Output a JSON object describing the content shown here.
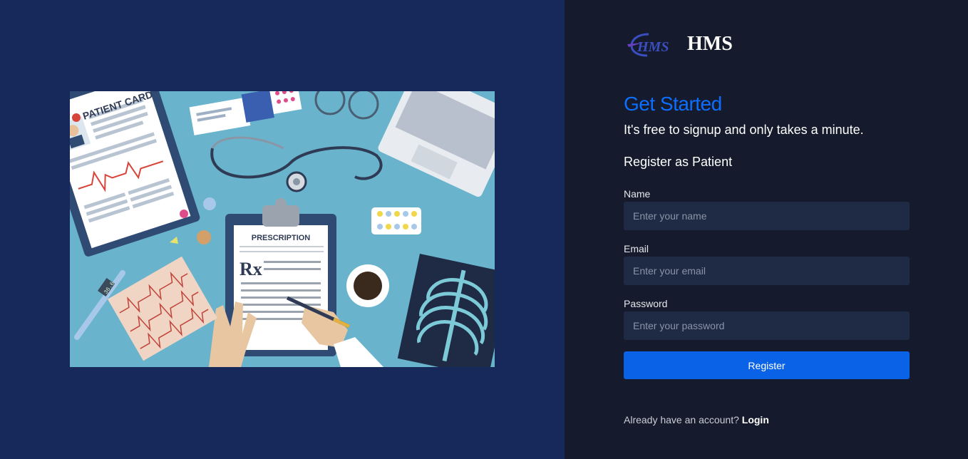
{
  "brand": {
    "logo_text": "HMS",
    "name": "HMS"
  },
  "hero": {
    "title": "Get Started",
    "subtitle": "It's free to signup and only takes a minute.",
    "role_heading": "Register as Patient"
  },
  "illustration": {
    "patient_card_label": "PATIENT CARD",
    "prescription_label": "PRESCRIPTION",
    "rx_label": "Rx",
    "thermometer_reading": "36.6"
  },
  "form": {
    "name": {
      "label": "Name",
      "placeholder": "Enter your name",
      "value": ""
    },
    "email": {
      "label": "Email",
      "placeholder": "Enter your email",
      "value": ""
    },
    "password": {
      "label": "Password",
      "placeholder": "Enter your password",
      "value": ""
    },
    "submit_label": "Register"
  },
  "footer": {
    "prompt": "Already have an account?",
    "login_label": "Login"
  },
  "colors": {
    "left_bg": "#17285a",
    "right_bg": "#151b2c",
    "accent": "#0d6efd",
    "button": "#0a63e6",
    "input_bg": "#1f2a44",
    "illustration_bg": "#69b4cc"
  },
  "icons": [
    "hms-logo-icon",
    "medical-desk-illustration"
  ]
}
